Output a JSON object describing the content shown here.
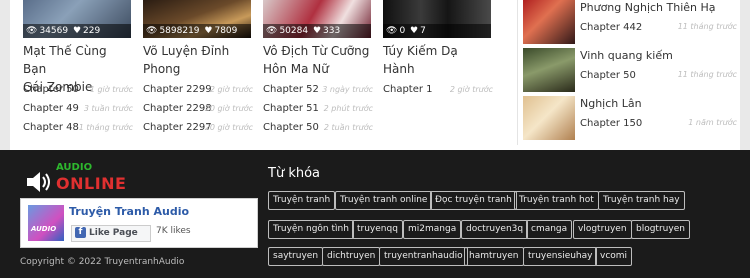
{
  "cards": [
    {
      "views": "34569",
      "likes": "229",
      "title_lines": [
        "Mạt Thế Cùng Bạn",
        "Gái Zombie"
      ],
      "chapters": [
        {
          "label": "Chapter 50",
          "ago": "1 giờ trước"
        },
        {
          "label": "Chapter 49",
          "ago": "3 tuần trước"
        },
        {
          "label": "Chapter 48",
          "ago": "1 tháng trước"
        }
      ]
    },
    {
      "views": "5898219",
      "likes": "7809",
      "title_lines": [
        "Võ Luyện Đỉnh",
        "Phong"
      ],
      "chapters": [
        {
          "label": "Chapter 2299",
          "ago": "2 giờ trước"
        },
        {
          "label": "Chapter 2298",
          "ago": "20 giờ trước"
        },
        {
          "label": "Chapter 2297",
          "ago": "20 giờ trước"
        }
      ]
    },
    {
      "views": "50284",
      "likes": "333",
      "title_lines": [
        "Vô Địch Từ Cưỡng",
        "Hôn Ma Nữ"
      ],
      "chapters": [
        {
          "label": "Chapter 52",
          "ago": "3 ngày trước"
        },
        {
          "label": "Chapter 51",
          "ago": "2 phút trước"
        },
        {
          "label": "Chapter 50",
          "ago": "2 tuần trước"
        }
      ]
    },
    {
      "views": "0",
      "likes": "7",
      "title_lines": [
        "Túy Kiếm Dạ Hành",
        ""
      ],
      "chapters": [
        {
          "label": "Chapter 1",
          "ago": "2 giờ trước"
        }
      ]
    }
  ],
  "sidebar": [
    {
      "name": "Phương Nghịch Thiên Hạ",
      "chapter": "Chapter 442",
      "ago": "11 tháng trước"
    },
    {
      "name": "Vinh quang kiếm",
      "chapter": "Chapter 50",
      "ago": "11 tháng trước"
    },
    {
      "name": "Nghịch Lân",
      "chapter": "Chapter 150",
      "ago": "1 năm trước"
    }
  ],
  "footer": {
    "logo_top": "AUDIO",
    "logo_bottom": "ONLINE",
    "fb_page_name": "Truyện Tranh Audio",
    "fb_like_label": "Like Page",
    "fb_likes": "7K likes",
    "fb_image_text": "AUDIO",
    "copyright": "Copyright © 2022 TruyentranhAudio",
    "keywords_title": "Từ khóa",
    "keywords": [
      "Truyện tranh",
      "Truyện tranh online",
      "Đọc truyện tranh",
      "Truyện tranh hot",
      "Truyện tranh hay",
      "Truyện ngôn tình",
      "truyenqq",
      "mi2manga",
      "doctruyen3q",
      "cmanga",
      "vlogtruyen",
      "blogtruyen",
      "saytruyen",
      "dichtruyen",
      "truyentranhaudio",
      "hamtruyen",
      "truyensieuhay",
      "vcomi"
    ]
  },
  "colors": {
    "footer_bg": "#1b1b1b",
    "logo_green": "#2eb82e",
    "logo_red": "#e03030",
    "fb_blue": "#4267b2"
  },
  "icons": [
    "eye-icon",
    "heart-icon",
    "speaker-icon",
    "facebook-icon"
  ]
}
